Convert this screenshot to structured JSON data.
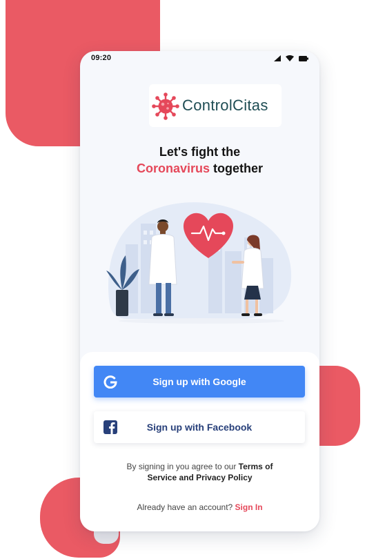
{
  "status_bar": {
    "time": "09:20"
  },
  "brand": {
    "name": "ControlCitas",
    "logo_icon": "virus-icon",
    "color_text": "#1f4d54",
    "color_accent": "#e5485a"
  },
  "headline": {
    "line1": "Let's fight the",
    "highlight": "Coronavirus",
    "rest": "together"
  },
  "illustration": {
    "icon": "doctors-heart-illustration"
  },
  "auth": {
    "google_label": "Sign up with Google",
    "google_icon": "google-icon",
    "google_color": "#4287f5",
    "facebook_label": "Sign up with Facebook",
    "facebook_icon": "facebook-icon",
    "facebook_color": "#28407a"
  },
  "terms": {
    "prefix": "By signing in you agree to our",
    "link1": "Terms of",
    "link2": "Service",
    "and": "and",
    "link3": "Privacy Policy"
  },
  "signin": {
    "prompt": "Already have an account?",
    "link": "Sign In"
  }
}
